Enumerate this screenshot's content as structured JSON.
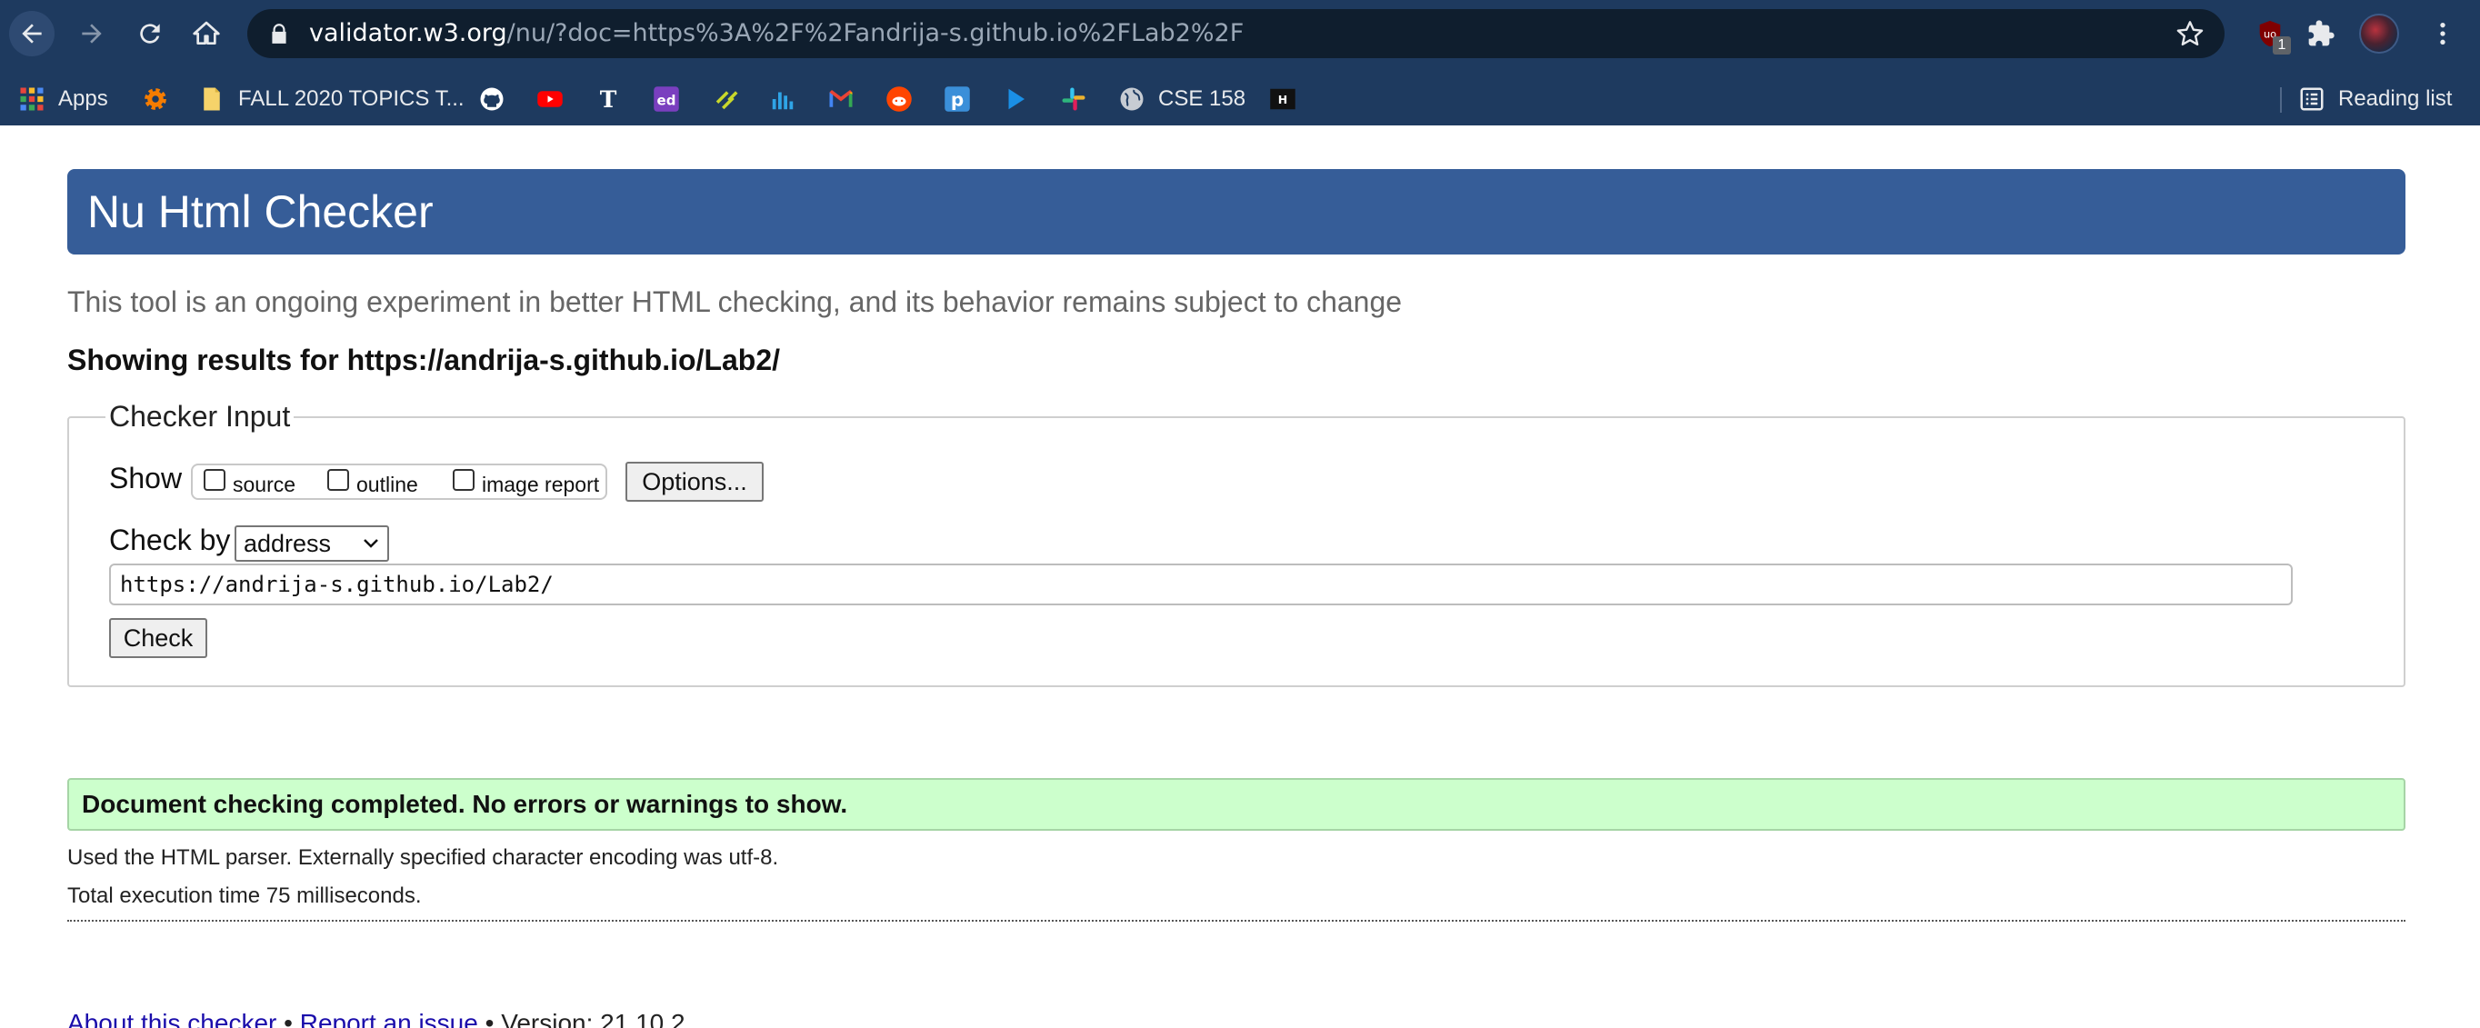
{
  "browser": {
    "url_host": "validator.w3.org",
    "url_path": "/nu/?doc=https%3A%2F%2Fandrija-s.github.io%2FLab2%2F",
    "ublock_badge": "1",
    "bookmarks": [
      {
        "label": "Apps",
        "icon": "apps-grid-icon"
      },
      {
        "label": "",
        "icon": "gear-orange-icon"
      },
      {
        "label": "FALL 2020 TOPICS T...",
        "icon": "folder-icon"
      },
      {
        "label": "",
        "icon": "github-icon"
      },
      {
        "label": "",
        "icon": "youtube-icon"
      },
      {
        "label": "",
        "icon": "nytimes-icon"
      },
      {
        "label": "",
        "icon": "ed-icon"
      },
      {
        "label": "",
        "icon": "highlighter-icon"
      },
      {
        "label": "",
        "icon": "bar-chart-icon"
      },
      {
        "label": "",
        "icon": "gmail-icon"
      },
      {
        "label": "",
        "icon": "reddit-icon"
      },
      {
        "label": "",
        "icon": "p-icon"
      },
      {
        "label": "",
        "icon": "play-icon"
      },
      {
        "label": "",
        "icon": "slack-icon"
      },
      {
        "label": "CSE 158",
        "icon": "globe-icon"
      },
      {
        "label": "",
        "icon": "hackernews-icon"
      }
    ],
    "reading_list": "Reading list"
  },
  "page": {
    "title": "Nu Html Checker",
    "tagline": "This tool is an ongoing experiment in better HTML checking, and its behavior remains subject to change",
    "results_for": "Showing results for https://andrija-s.github.io/Lab2/",
    "checker_input": {
      "legend": "Checker Input",
      "show_label": "Show",
      "options": [
        {
          "label": "source",
          "checked": false
        },
        {
          "label": "outline",
          "checked": false
        },
        {
          "label": "image report",
          "checked": false
        }
      ],
      "options_button": "Options...",
      "check_by_label": "Check by",
      "check_by_value": "address",
      "url_value": "https://andrija-s.github.io/Lab2/",
      "check_button": "Check"
    },
    "success_message": "Document checking completed. No errors or warnings to show.",
    "parser_info": "Used the HTML parser. Externally specified character encoding was utf-8.",
    "execution_time": "Total execution time 75 milliseconds.",
    "footer": {
      "about_link": "About this checker",
      "separator": "•",
      "report_link": "Report an issue",
      "version": "Version: 21.10.2"
    }
  },
  "colors": {
    "chrome_bg": "#1e3a5f",
    "header_blue": "#365d98",
    "success_bg": "#ccffcc",
    "link": "#1a0dab"
  }
}
